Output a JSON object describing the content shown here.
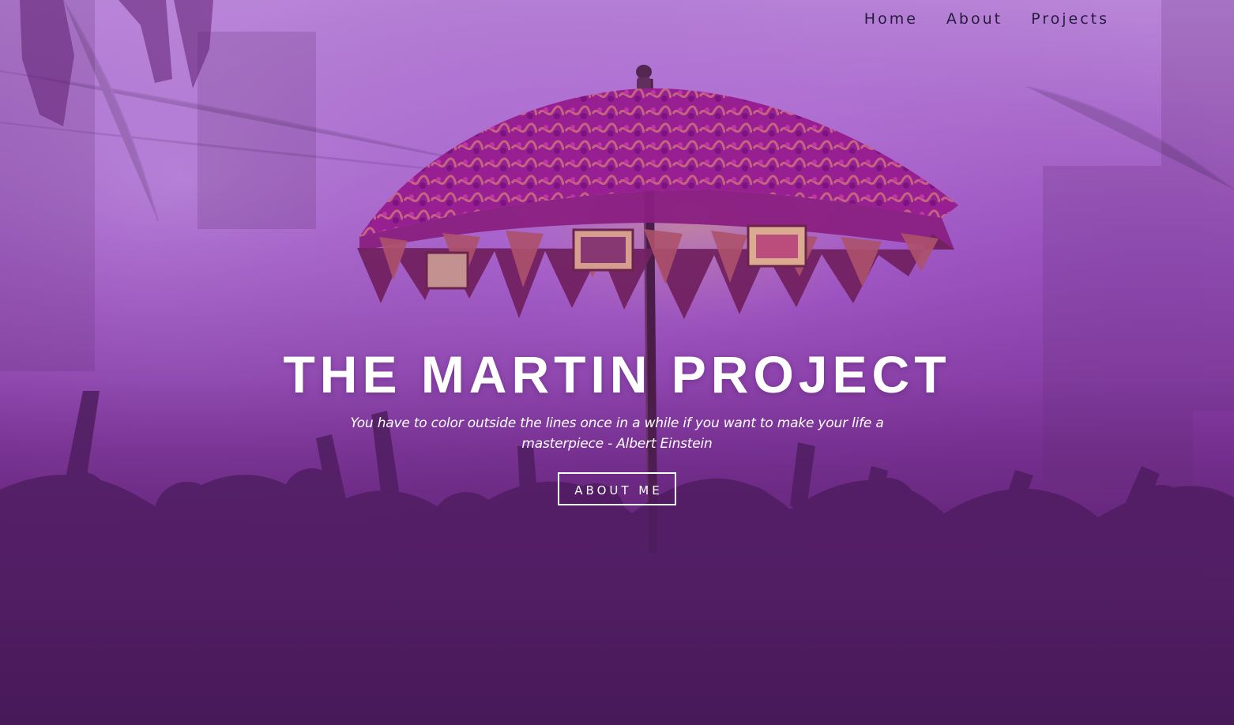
{
  "nav": {
    "items": [
      {
        "label": "Home"
      },
      {
        "label": "About"
      },
      {
        "label": "Projects"
      }
    ]
  },
  "hero": {
    "title": "THE MARTIN PROJECT",
    "quote": "You have to color outside the lines once in a while if you want to make your life a masterpiece - Albert Einstein",
    "button_label": "ABOUT ME"
  },
  "colors": {
    "overlay": "#7a2f99",
    "nav_text": "#241c3b",
    "hero_text": "#ffffff"
  }
}
